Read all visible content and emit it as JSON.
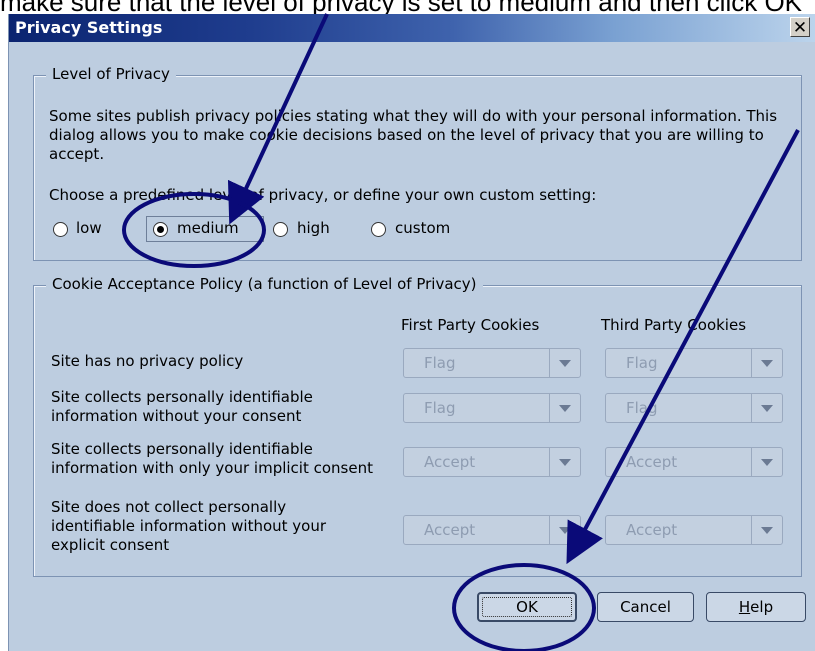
{
  "caption": "make sure that the level of privacy is set to medium and then click OK",
  "dialog": {
    "title": "Privacy Settings",
    "close_glyph": "✕"
  },
  "level_group": {
    "legend": "Level of Privacy",
    "description": "Some sites publish privacy policies stating what they will do with your personal information. This dialog allows you to make cookie decisions based on the level of privacy that you are willing to accept.",
    "choose_text": "Choose a predefined level of privacy, or define your own custom setting:",
    "options": [
      {
        "label": "low",
        "checked": false
      },
      {
        "label": "medium",
        "checked": true
      },
      {
        "label": "high",
        "checked": false
      },
      {
        "label": "custom",
        "checked": false
      }
    ]
  },
  "cookie_group": {
    "legend": "Cookie Acceptance Policy (a function of Level of Privacy)",
    "columns": [
      "First Party Cookies",
      "Third Party Cookies"
    ],
    "rows": [
      {
        "label": "Site has no privacy policy",
        "first": "Flag",
        "third": "Flag"
      },
      {
        "label": "Site collects personally identifiable information without your consent",
        "first": "Flag",
        "third": "Flag"
      },
      {
        "label": "Site collects personally identifiable information with only your implicit consent",
        "first": "Accept",
        "third": "Accept"
      },
      {
        "label": "Site does not collect personally identifiable information without your explicit consent",
        "first": "Accept",
        "third": "Accept"
      }
    ]
  },
  "buttons": {
    "ok": "OK",
    "cancel": "Cancel",
    "help_mnemonic": "H",
    "help_rest": "elp"
  },
  "annotation_color": "#0a0a78"
}
